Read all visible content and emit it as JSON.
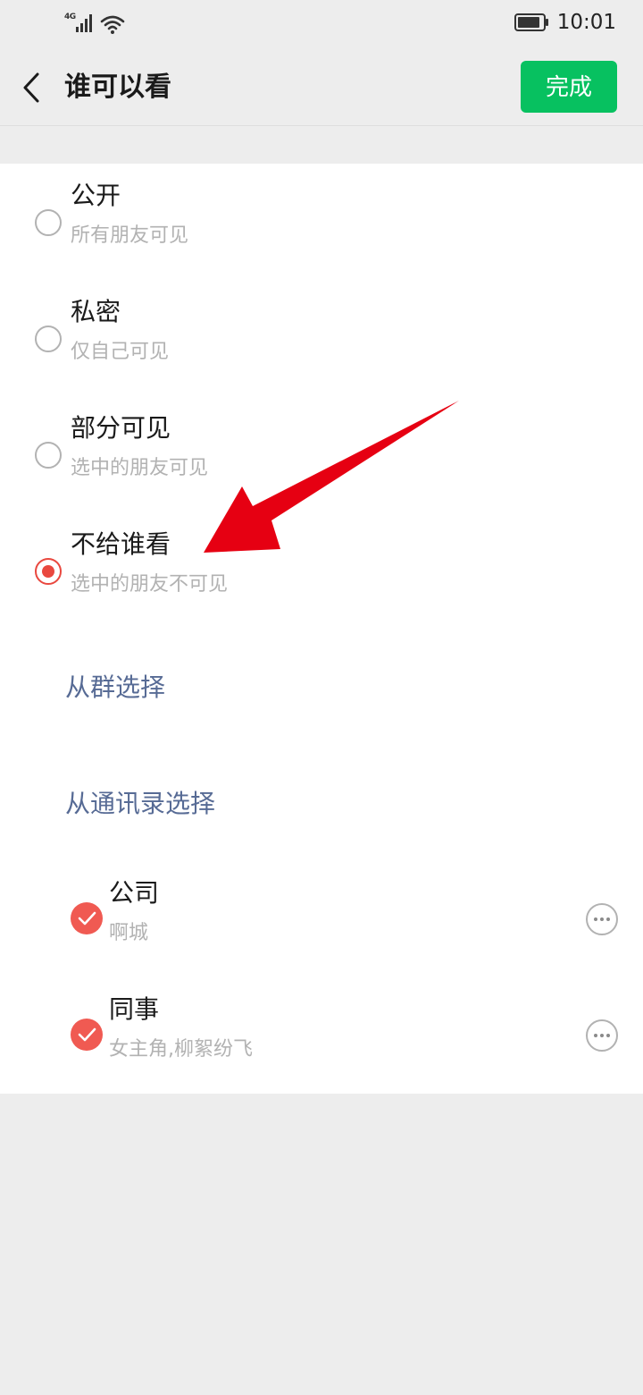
{
  "status_bar": {
    "network": "4G",
    "time": "10:01"
  },
  "header": {
    "back_icon": "chevron-left-icon",
    "title": "谁可以看",
    "done_label": "完成",
    "done_color": "#07c160"
  },
  "options": [
    {
      "title": "公开",
      "subtitle": "所有朋友可见",
      "selected": false
    },
    {
      "title": "私密",
      "subtitle": "仅自己可见",
      "selected": false
    },
    {
      "title": "部分可见",
      "subtitle": "选中的朋友可见",
      "selected": false
    },
    {
      "title": "不给谁看",
      "subtitle": "选中的朋友不可见",
      "selected": true
    }
  ],
  "links": {
    "from_group": "从群选择",
    "from_contacts": "从通讯录选择",
    "link_color": "#576b95"
  },
  "groups": [
    {
      "title": "公司",
      "members": "啊城",
      "checked": true
    },
    {
      "title": "同事",
      "members": "女主角,柳絮纷飞",
      "checked": true
    }
  ],
  "colors": {
    "accent_red": "#e9483f",
    "arrow_red": "#e60012",
    "background": "#ededed"
  }
}
